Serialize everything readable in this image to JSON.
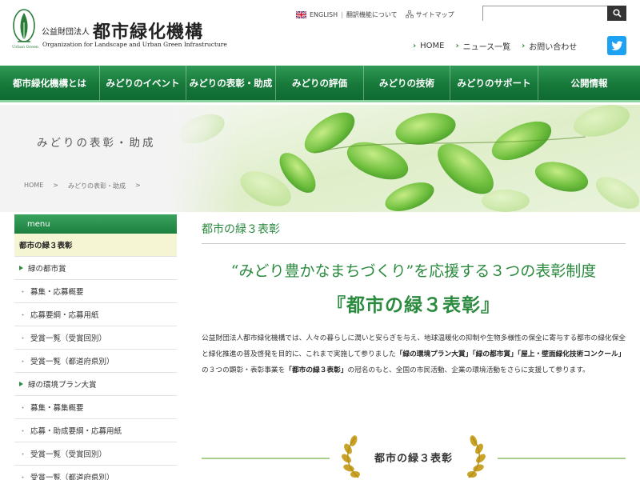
{
  "header": {
    "org_kind": "公益財団法人",
    "org_name": "都市緑化機構",
    "org_name_en": "Organization for Landscape and Urban Green Infrastructure",
    "logo_small_text": "Urban Green",
    "util_english": "ENGLISH",
    "util_translation": "翻訳機能について",
    "util_sitemap": "サイトマップ",
    "search_placeholder": "",
    "quick_links": [
      "HOME",
      "ニュース一覧",
      "お問い合わせ"
    ]
  },
  "nav": [
    "都市緑化機構とは",
    "みどりのイベント",
    "みどりの表彰・助成",
    "みどりの評価",
    "みどりの技術",
    "みどりのサポート",
    "公開情報"
  ],
  "hero": {
    "title": "みどりの表彰・助成",
    "breadcrumb": [
      "HOME",
      ">",
      "みどりの表彰・助成",
      ">"
    ]
  },
  "sidebar": {
    "head": "menu",
    "items": [
      {
        "label": "都市の緑３表彰",
        "kind": "active"
      },
      {
        "label": "緑の都市賞",
        "kind": "section"
      },
      {
        "label": "募集・応募概要",
        "kind": "sub"
      },
      {
        "label": "応募要綱・応募用紙",
        "kind": "sub"
      },
      {
        "label": "受賞一覧（受賞回別）",
        "kind": "sub"
      },
      {
        "label": "受賞一覧（都道府県別）",
        "kind": "sub"
      },
      {
        "label": "緑の環境プラン大賞",
        "kind": "section"
      },
      {
        "label": "募集・募集概要",
        "kind": "sub"
      },
      {
        "label": "応募・助成要綱・応募用紙",
        "kind": "sub"
      },
      {
        "label": "受賞一覧（受賞回別）",
        "kind": "sub"
      },
      {
        "label": "受賞一覧（都道府県別）",
        "kind": "sub"
      }
    ]
  },
  "main": {
    "section_title": "都市の緑３表彰",
    "lead1": "“みどり豊かなまちづくり”を応援する３つの表彰制度",
    "lead2": "『都市の緑３表彰』",
    "body": [
      {
        "t": "公益財団法人都市緑化機構では、人々の暮らしに潤いと安らぎを与え、地球温暖化の抑制や生物多様性の保全に寄与する都市の緑化保全と緑化推進の普及啓発を目的に、これまで実施して参りました",
        "b": false
      },
      {
        "t": "「緑の環境プラン大賞」「緑の都市賞」「屋上・壁面緑化技術コンクール」",
        "b": true
      },
      {
        "t": "の３つの顕彰・表彰事業を",
        "b": false
      },
      {
        "t": "「都市の緑３表彰」",
        "b": true
      },
      {
        "t": "の冠名のもと、全国の市民活動、企業の環境活動をさらに支援して参ります。",
        "b": false
      }
    ],
    "award_label": "都市の緑３表彰"
  },
  "colors": {
    "brand_green": "#2a8a3e",
    "nav_green": "#17793a",
    "twitter_blue": "#1da1f2"
  },
  "icons": [
    "logo-emblem",
    "uk-flag-icon",
    "sitemap-icon",
    "search-icon",
    "chevron-right-icon",
    "twitter-icon",
    "triangle-right-icon",
    "laurel-icon"
  ]
}
